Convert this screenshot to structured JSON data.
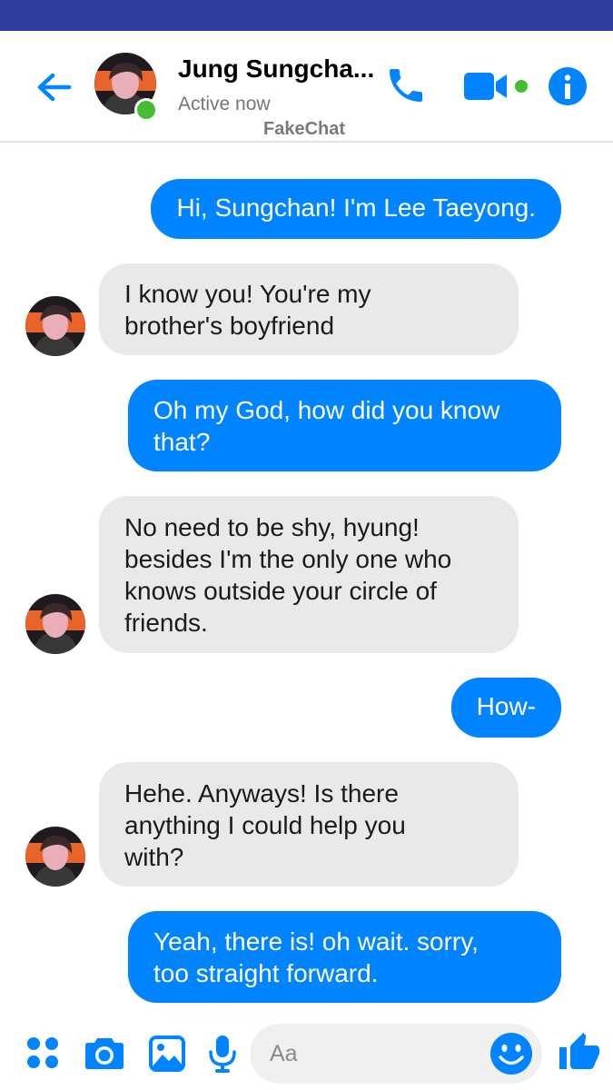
{
  "colors": {
    "status_bar": "#2f3e9e",
    "accent_blue": "#0084ff",
    "incoming_bubble": "#e9e9e9",
    "online_green": "#44bd32"
  },
  "header": {
    "contact_name": "Jung Sungcha...",
    "status": "Active now",
    "watermark": "FakeChat",
    "icons": [
      "back-arrow-icon",
      "phone-icon",
      "video-camera-icon",
      "info-icon"
    ]
  },
  "messages": [
    {
      "dir": "out",
      "text": "Hi, Sungchan!  I'm Lee Taeyong."
    },
    {
      "dir": "in",
      "text": " I know you! You're my\nbrother's boyfriend"
    },
    {
      "dir": "out",
      "text": "Oh my God,  how did you know\nthat?"
    },
    {
      "dir": "in",
      "text": "No need to be shy, hyung!\nbesides I'm the only one who\nknows outside your circle of\nfriends."
    },
    {
      "dir": "out",
      "text": "How-"
    },
    {
      "dir": "in",
      "text": "Hehe. Anyways! Is there\nanything I could help you\nwith?"
    },
    {
      "dir": "out",
      "text": "Yeah, there is! oh wait. sorry,\ntoo straight forward."
    }
  ],
  "composer": {
    "placeholder": "Aa",
    "icons": [
      "apps-grid-icon",
      "camera-icon",
      "image-icon",
      "microphone-icon",
      "emoji-icon",
      "thumbs-up-icon"
    ]
  }
}
